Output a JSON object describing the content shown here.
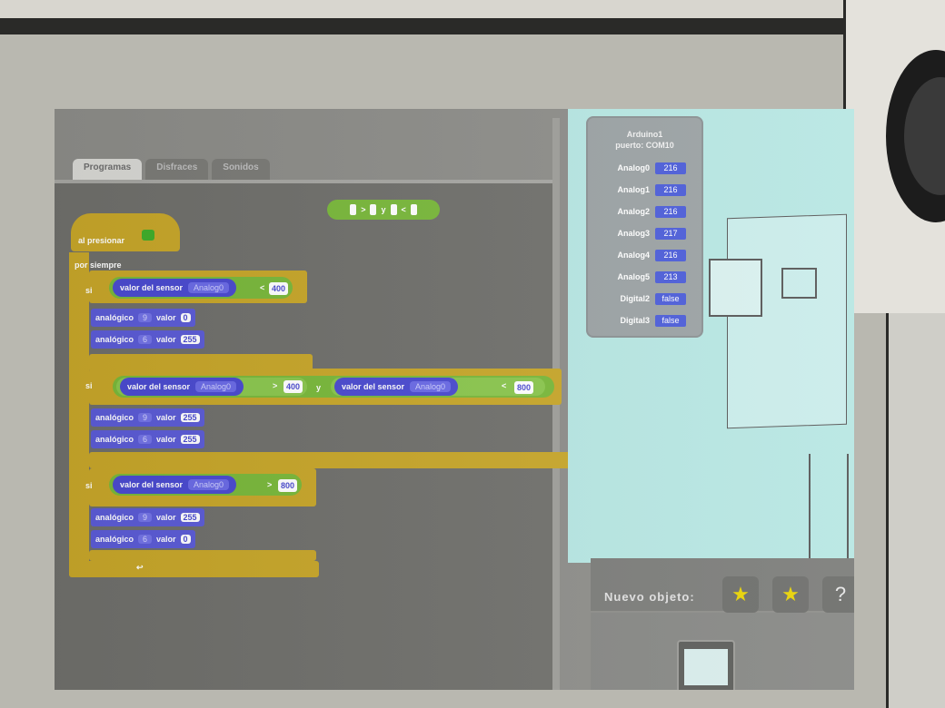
{
  "tabs": [
    "Programas",
    "Disfraces",
    "Sonidos"
  ],
  "and_block": {
    "op_gt": ">",
    "op_and": "y",
    "op_lt": "<"
  },
  "hat_label": "al presionar",
  "forever_label": "por siempre",
  "if_label": "si",
  "sensor_label": "valor del sensor",
  "sensor_port": "Analog0",
  "analog_label": "analógico",
  "pin_9": "9",
  "pin_6": "6",
  "value_label": "valor",
  "if1": {
    "op": "<",
    "num": "400"
  },
  "if1_cmds": [
    {
      "pin": "9",
      "val": "0"
    },
    {
      "pin": "6",
      "val": "255"
    }
  ],
  "if2": {
    "op1": ">",
    "num1": "400",
    "conj": "y",
    "op2": "<",
    "num2": "800"
  },
  "if2_cmds": [
    {
      "pin": "9",
      "val": "255"
    },
    {
      "pin": "6",
      "val": "255"
    }
  ],
  "if3": {
    "op": ">",
    "num": "800"
  },
  "if3_cmds": [
    {
      "pin": "9",
      "val": "255"
    },
    {
      "pin": "6",
      "val": "0"
    }
  ],
  "watcher": {
    "title_line1": "Arduino1",
    "title_line2": "puerto: COM10",
    "rows": [
      {
        "name": "Analog0",
        "value": "216"
      },
      {
        "name": "Analog1",
        "value": "216"
      },
      {
        "name": "Analog2",
        "value": "216"
      },
      {
        "name": "Analog3",
        "value": "217"
      },
      {
        "name": "Analog4",
        "value": "216"
      },
      {
        "name": "Analog5",
        "value": "213"
      },
      {
        "name": "Digital2",
        "value": "false"
      },
      {
        "name": "Digital3",
        "value": "false"
      }
    ]
  },
  "nuevo_objeto": "Nuevo objeto:",
  "sprite_buttons": [
    "★",
    "★",
    "?"
  ]
}
